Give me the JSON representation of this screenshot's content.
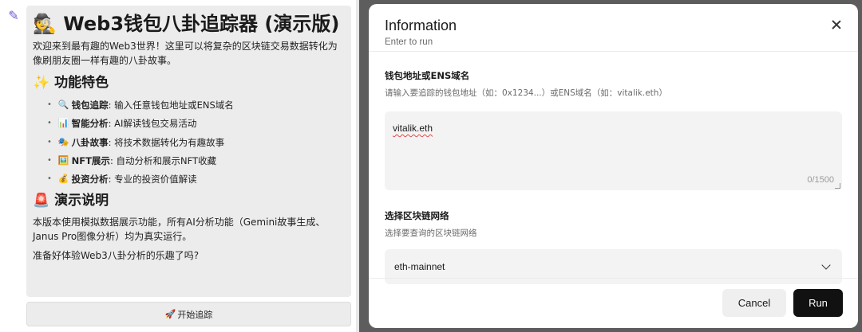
{
  "chat": {
    "title": "🕵️ Web3钱包八卦追踪器 (演示版)",
    "intro": "欢迎来到最有趣的Web3世界！这里可以将复杂的区块链交易数据转化为像刷朋友圈一样有趣的八卦故事。",
    "features_heading": "✨ 功能特色",
    "features": [
      {
        "icon": "🔍",
        "name": "钱包追踪",
        "desc": ": 输入任意钱包地址或ENS域名"
      },
      {
        "icon": "📊",
        "name": "智能分析",
        "desc": ": AI解读钱包交易活动"
      },
      {
        "icon": "🎭",
        "name": "八卦故事",
        "desc": ": 将技术数据转化为有趣故事"
      },
      {
        "icon": "🖼️",
        "name": "NFT展示",
        "desc": ": 自动分析和展示NFT收藏"
      },
      {
        "icon": "💰",
        "name": "投资分析",
        "desc": ": 专业的投资价值解读"
      }
    ],
    "demo_heading": "🚨 演示说明",
    "demo_text": "本版本使用模拟数据展示功能，所有AI分析功能（Gemini故事生成、Janus Pro图像分析）均为真实运行。",
    "ready": "准备好体验Web3八卦分析的乐趣了吗?",
    "start_button": {
      "icon": "🚀",
      "label": "开始追踪"
    }
  },
  "modal": {
    "title": "Information",
    "subtitle": "Enter to run",
    "field1": {
      "label": "钱包地址或ENS域名",
      "description": "请输入要追踪的钱包地址（如：0x1234...）或ENS域名（如：vitalik.eth）",
      "value": "vitalik.eth",
      "char_count": "0/1500"
    },
    "field2": {
      "label": "选择区块链网络",
      "description": "选择要查询的区块链网络",
      "value": "eth-mainnet"
    },
    "cancel_label": "Cancel",
    "run_label": "Run"
  }
}
